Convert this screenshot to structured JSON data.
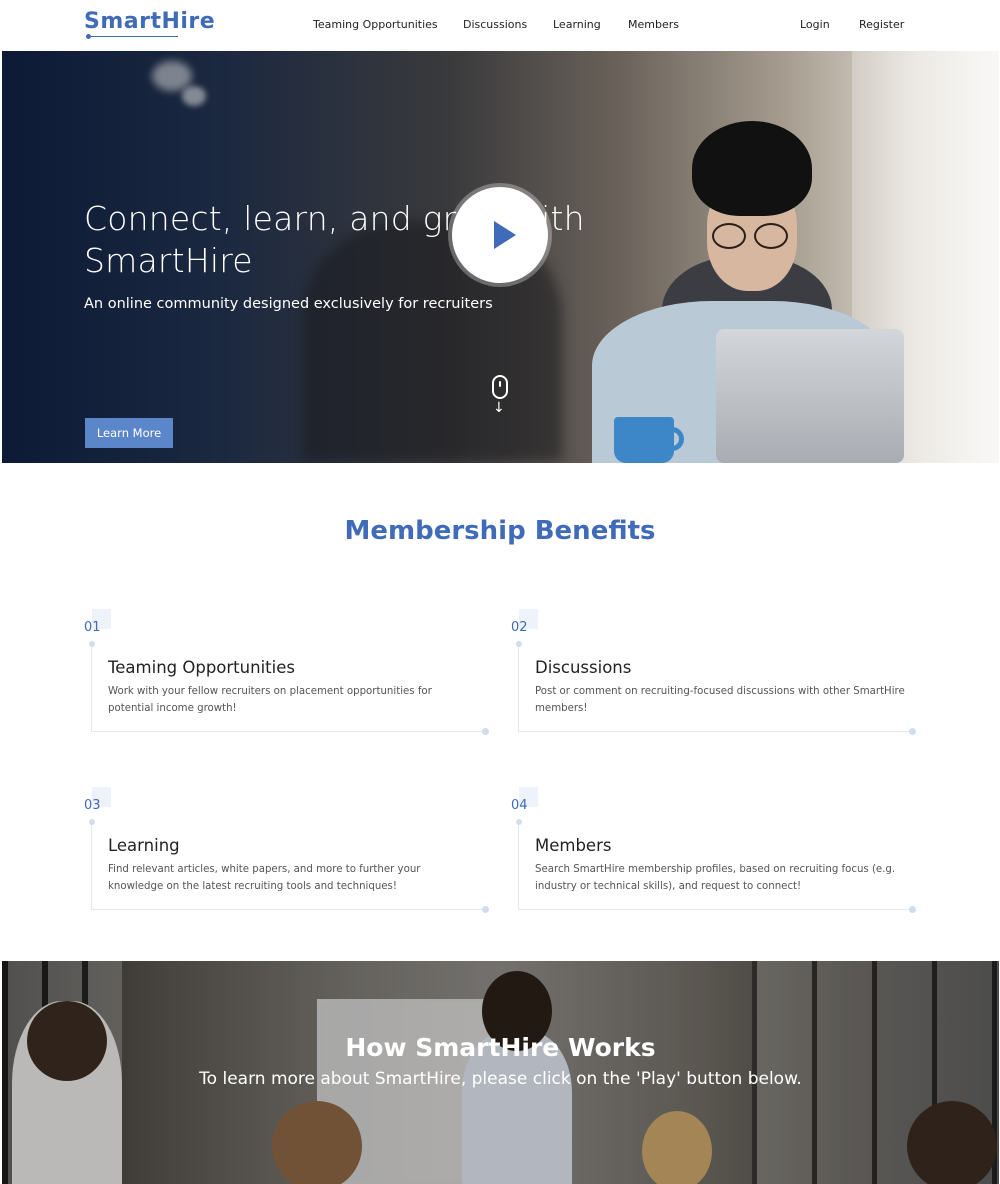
{
  "nav": {
    "logo": "SmartHire",
    "links": [
      "Teaming Opportunities",
      "Discussions",
      "Learning",
      "Members"
    ],
    "login": "Login",
    "register": "Register"
  },
  "hero": {
    "title": "Connect, learn, and grow with SmartHire",
    "subtitle": "An online community designed exclusively for recruiters",
    "button": "Learn More",
    "scroll_icon": "mouse-scroll-icon"
  },
  "benefits": {
    "title": "Membership Benefits",
    "items": [
      {
        "num": "01",
        "title": "Teaming Opportunities",
        "desc": "Work with your fellow recruiters on placement opportunities for potential income growth!"
      },
      {
        "num": "02",
        "title": "Discussions",
        "desc": "Post or comment on recruiting-focused discussions with other SmartHire members!"
      },
      {
        "num": "03",
        "title": "Learning",
        "desc": "Find relevant articles, white papers, and more to further your knowledge on the latest recruiting tools and techniques!"
      },
      {
        "num": "04",
        "title": "Members",
        "desc": "Search SmartHire membership profiles, based on recruiting focus (e.g. industry or technical skills), and request to connect!"
      }
    ]
  },
  "how": {
    "title": "How SmartHire Works",
    "subtitle": "To learn more about SmartHire, please click on the 'Play' button below.",
    "play_icon": "play-icon"
  },
  "colors": {
    "brand": "#3f6bb8",
    "button": "#5b86c9"
  }
}
